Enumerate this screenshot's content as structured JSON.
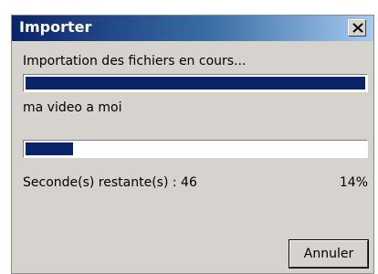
{
  "window": {
    "title": "Importer",
    "close_icon": "close-icon"
  },
  "status": {
    "message": "Importation des fichiers en cours...",
    "overall_progress": 1.0,
    "current_file": "ma  video a moi",
    "file_progress": 0.14,
    "time_remaining": "Seconde(s) restante(s) : 46",
    "percent_label": "14%"
  },
  "buttons": {
    "cancel_label": "Annuler"
  },
  "colors": {
    "progress_fill": "#0a246a",
    "dialog_bg": "#d6d3ce"
  }
}
